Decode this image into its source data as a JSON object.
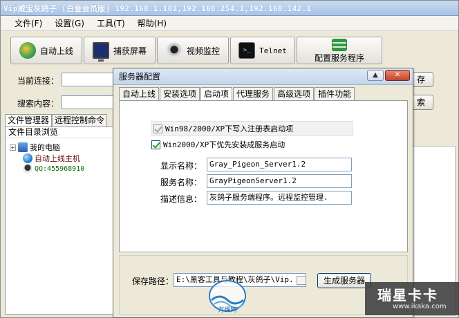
{
  "window": {
    "title": "Vip威宝灰鸽子 [白金会员版]  192.168.1.101,192.168.254.1,192.168.142.1"
  },
  "menu": {
    "items": [
      {
        "label": "文件(F)"
      },
      {
        "label": "设置(G)"
      },
      {
        "label": "工具(T)"
      },
      {
        "label": "帮助(H)"
      }
    ]
  },
  "toolbar": {
    "auto_online": "自动上线",
    "capture_screen": "捕获屏幕",
    "video_monitor": "视频监控",
    "telnet": "Telnet",
    "config_server": "配置服务程序"
  },
  "connection": {
    "current_label": "当前连接：",
    "search_label": "搜索内容：",
    "right_btn_1": "存",
    "right_btn_2": "索"
  },
  "left_panel": {
    "tabs": [
      {
        "label": "文件管理器"
      },
      {
        "label": "远程控制命令"
      }
    ],
    "header": "文件目录浏览",
    "tree": {
      "my_computer": "我的电脑",
      "auto_online_host": "自动上线主机",
      "qq": "QQ:455968910"
    }
  },
  "dialog": {
    "title": "服务器配置",
    "tabs": [
      {
        "label": "自动上线"
      },
      {
        "label": "安装选项"
      },
      {
        "label": "启动项"
      },
      {
        "label": "代理服务"
      },
      {
        "label": "高级选项"
      },
      {
        "label": "插件功能"
      }
    ],
    "active_tab": "启动项",
    "options": {
      "reg_startup": {
        "label": "Win98/2000/XP下写入注册表启动项",
        "checked": true
      },
      "service_startup": {
        "label": "Win2000/XP下优先安装成服务启动",
        "checked": true
      }
    },
    "fields": {
      "display_name": {
        "label": "显示名称：",
        "value": "Gray_Pigeon_Server1.2"
      },
      "service_name": {
        "label": "服务名称：",
        "value": "GrayPigeonServer1.2"
      },
      "description": {
        "label": "描述信息：",
        "value": "灰鸽子服务端程序。远程监控管理."
      }
    },
    "save": {
      "label": "保存路径：",
      "value": "E:\\黑客工具与教程\\灰鸽子\\Vip.",
      "button": "生成服务器"
    },
    "close_glyph": "✕",
    "min_glyph": "▲"
  },
  "watermark": {
    "big": "瑞星卡卡",
    "small": "www.ikaka.com"
  },
  "logo_text": "万维网"
}
